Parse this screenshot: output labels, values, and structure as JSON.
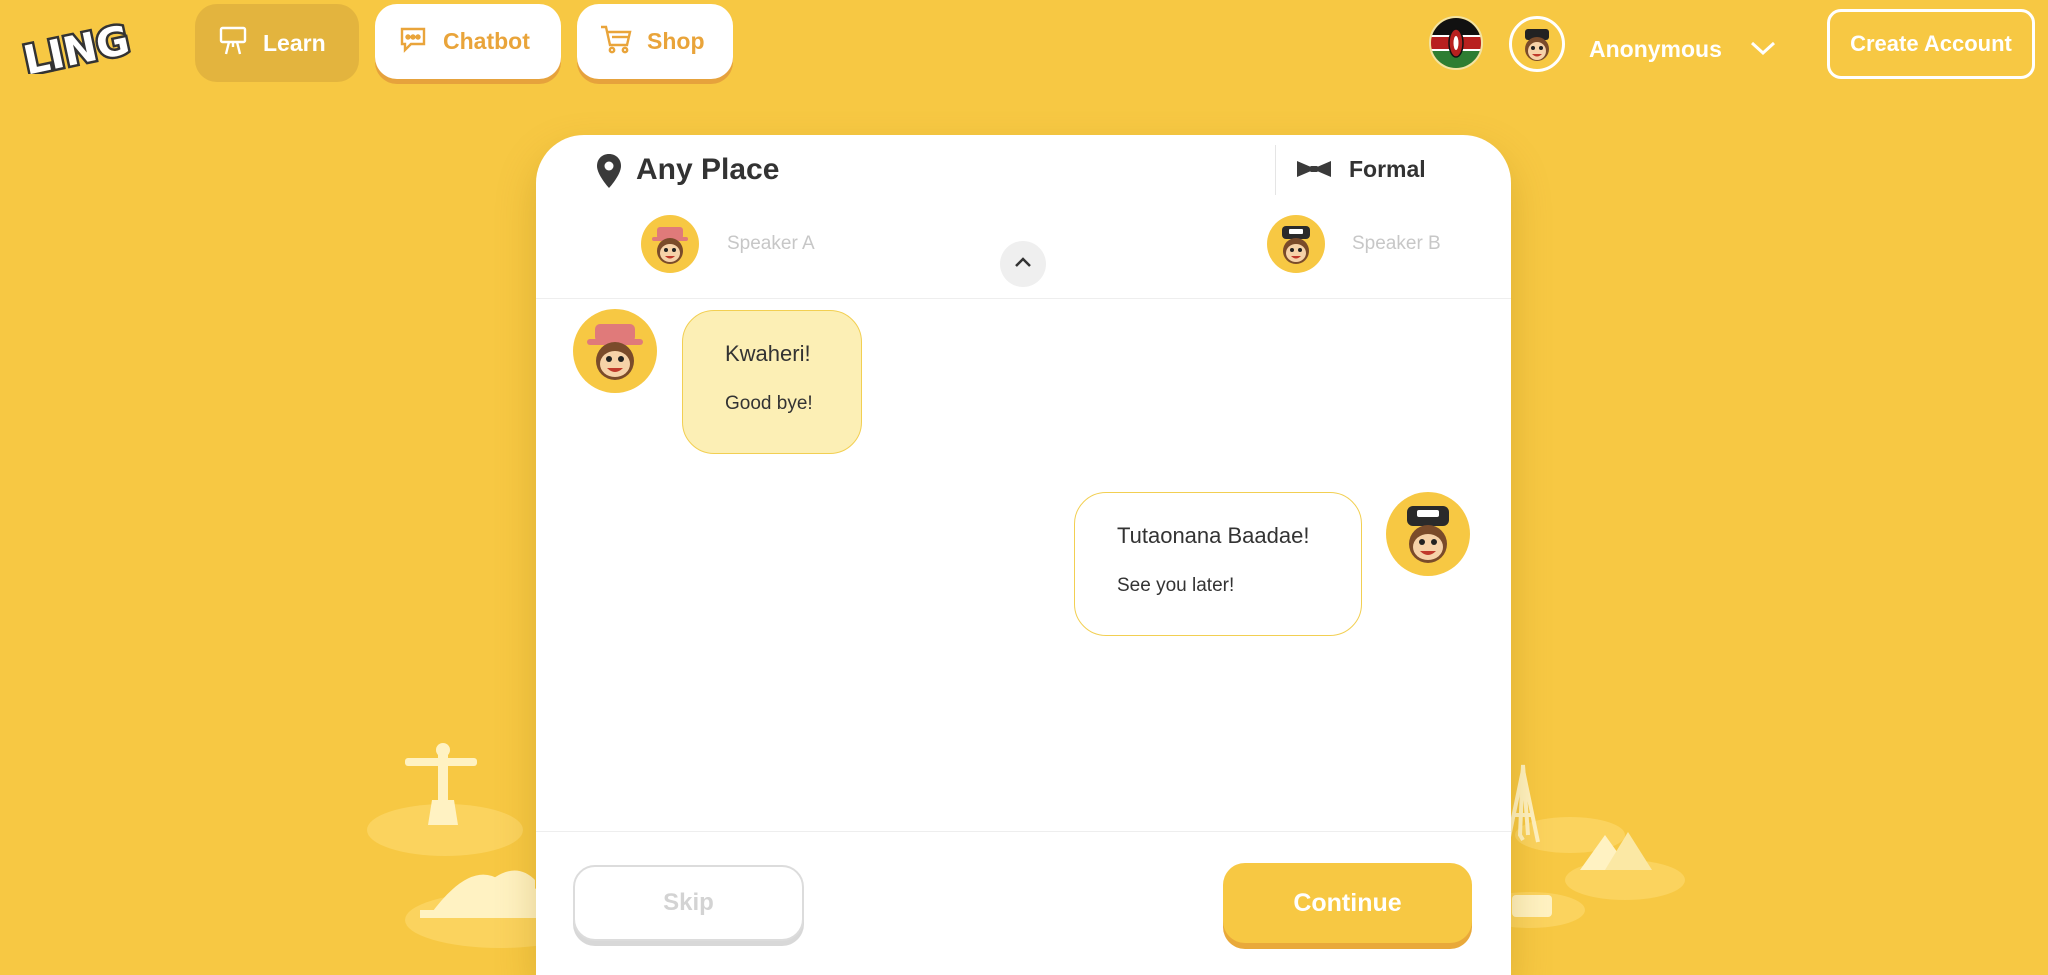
{
  "brand": {
    "logo_text": "LING"
  },
  "nav": {
    "learn_label": "Learn",
    "chatbot_label": "Chatbot",
    "shop_label": "Shop"
  },
  "user": {
    "name": "Anonymous",
    "create_account_label": "Create Account",
    "flag": "kenya-flag"
  },
  "chat": {
    "place": "Any Place",
    "formality": "Formal",
    "speaker_a": "Speaker A",
    "speaker_b": "Speaker B",
    "messages": [
      {
        "speaker": "A",
        "text": "Kwaheri!",
        "translation": "Good bye!"
      },
      {
        "speaker": "B",
        "text": "Tutaonana Baadae!",
        "translation": "See you later!"
      }
    ]
  },
  "actions": {
    "skip_label": "Skip",
    "continue_label": "Continue"
  },
  "colors": {
    "background": "#f7c843",
    "accent_orange": "#e9a43a",
    "bubble_a": "#fcefb5"
  }
}
